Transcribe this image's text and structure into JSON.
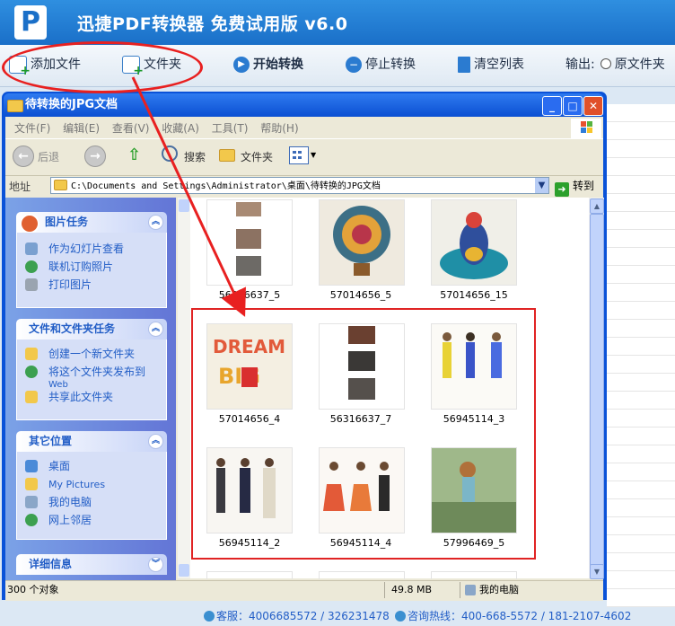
{
  "app": {
    "title": "迅捷PDF转换器 免费试用版 v6.0",
    "logo": "P"
  },
  "toolbar": {
    "add_file": "添加文件",
    "folder": "文件夹",
    "start": "开始转换",
    "stop": "停止转换",
    "clear": "清空列表",
    "output_label": "输出:",
    "output_option": "原文件夹"
  },
  "explorer": {
    "title": "待转换的JPG文档",
    "menu": [
      "文件(F)",
      "编辑(E)",
      "查看(V)",
      "收藏(A)",
      "工具(T)",
      "帮助(H)"
    ],
    "back": "后退",
    "search": "搜索",
    "folders": "文件夹",
    "address_label": "地址",
    "address": "C:\\Documents and Settings\\Administrator\\桌面\\待转换的JPG文档",
    "go": "转到",
    "panels": {
      "picture_tasks": {
        "title": "图片任务",
        "items": [
          "作为幻灯片查看",
          "联机订购照片",
          "打印图片"
        ]
      },
      "file_tasks": {
        "title": "文件和文件夹任务",
        "items": [
          "创建一个新文件夹",
          "将这个文件夹发布到",
          "Web",
          "共享此文件夹"
        ]
      },
      "other_places": {
        "title": "其它位置",
        "items": [
          "桌面",
          "My Pictures",
          "我的电脑",
          "网上邻居"
        ]
      },
      "details": {
        "title": "详细信息"
      }
    },
    "files": [
      {
        "name": "56316637_5"
      },
      {
        "name": "57014656_5"
      },
      {
        "name": "57014656_15"
      },
      {
        "name": "57014656_4"
      },
      {
        "name": "56316637_7"
      },
      {
        "name": "56945114_3"
      },
      {
        "name": "56945114_2"
      },
      {
        "name": "56945114_4"
      },
      {
        "name": "57996469_5"
      }
    ],
    "status": {
      "count": "300 个对象",
      "size": "49.8 MB",
      "location": "我的电脑"
    }
  },
  "footer": {
    "service": "客服：4006685572 / 326231478",
    "hotline": "咨询热线：400-668-5572 / 181-2107-4602"
  }
}
